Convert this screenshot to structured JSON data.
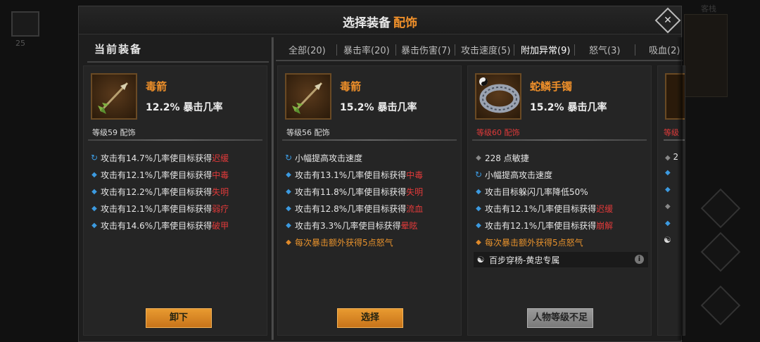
{
  "background": {
    "left_number": "25",
    "minimap_label": "客栈"
  },
  "modal": {
    "title": "选择装备",
    "title_accent": "配饰",
    "close_symbol": "✕"
  },
  "left_panel": {
    "title": "当前装备"
  },
  "tabs": [
    {
      "label": "全部(20)",
      "active": false
    },
    {
      "label": "暴击率(20)",
      "active": false
    },
    {
      "label": "暴击伤害(7)",
      "active": false
    },
    {
      "label": "攻击速度(5)",
      "active": false
    },
    {
      "label": "附加异常(9)",
      "active": true
    },
    {
      "label": "怒气(3)",
      "active": false
    },
    {
      "label": "吸血(2)",
      "active": false
    }
  ],
  "cards": [
    {
      "icon": "poison-arrow-icon",
      "name": "毒箭",
      "crit": "12.2% 暴击几率",
      "level": "等级59 配饰",
      "attrs": [
        {
          "icon": "refresh",
          "text": "攻击有14.7%几率使目标获得",
          "highlight": "迟缓"
        },
        {
          "icon": "diamond-blue",
          "text": "攻击有12.1%几率使目标获得",
          "highlight": "中毒"
        },
        {
          "icon": "diamond-blue",
          "text": "攻击有12.2%几率使目标获得",
          "highlight": "失明"
        },
        {
          "icon": "diamond-blue",
          "text": "攻击有12.1%几率使目标获得",
          "highlight": "弱疗"
        },
        {
          "icon": "diamond-blue",
          "text": "攻击有14.6%几率使目标获得",
          "highlight": "破甲"
        }
      ],
      "button": "卸下"
    },
    {
      "icon": "poison-arrow-icon",
      "name": "毒箭",
      "crit": "15.2% 暴击几率",
      "level": "等级56 配饰",
      "attrs": [
        {
          "icon": "refresh",
          "text": "小幅提高攻击速度",
          "highlight": ""
        },
        {
          "icon": "diamond-blue",
          "text": "攻击有13.1%几率使目标获得",
          "highlight": "中毒"
        },
        {
          "icon": "diamond-blue",
          "text": "攻击有11.8%几率使目标获得",
          "highlight": "失明"
        },
        {
          "icon": "diamond-blue",
          "text": "攻击有12.8%几率使目标获得",
          "highlight": "流血"
        },
        {
          "icon": "diamond-blue",
          "text": "攻击有3.3%几率使目标获得",
          "highlight": "晕眩"
        },
        {
          "icon": "diamond-orange",
          "text": "每次暴击额外获得5点怒气",
          "highlight": ""
        }
      ],
      "button": "选择"
    },
    {
      "icon": "snake-scale-bracelet-icon",
      "name": "蛇鳞手镯",
      "crit": "15.2% 暴击几率",
      "level": "等级60 配饰",
      "attrs": [
        {
          "icon": "diamond-gray",
          "text": "228 点敏捷",
          "highlight": ""
        },
        {
          "icon": "refresh",
          "text": "小幅提高攻击速度",
          "highlight": ""
        },
        {
          "icon": "diamond-blue",
          "text": "攻击目标躲闪几率降低50%",
          "highlight": ""
        },
        {
          "icon": "diamond-blue",
          "text": "攻击有12.1%几率使目标获得",
          "highlight": "迟缓"
        },
        {
          "icon": "diamond-blue",
          "text": "攻击有12.1%几率使目标获得",
          "highlight": "崩解"
        },
        {
          "icon": "diamond-orange",
          "text": "每次暴击额外获得5点怒气",
          "highlight": ""
        }
      ],
      "set_text": "百步穿杨-黄忠专属",
      "button": "人物等级不足"
    }
  ],
  "peek_card": {
    "level_fragment": "等级",
    "attr_fragment": "2"
  },
  "colors": {
    "accent": "#f0902a",
    "highlight_red": "#e03a3a",
    "bullet_blue": "#3c9ae0",
    "button_orange": "#e08a2a"
  }
}
